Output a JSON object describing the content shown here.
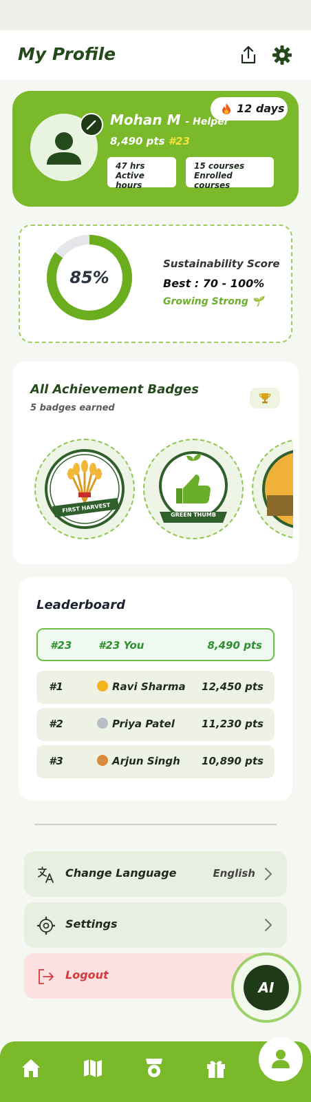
{
  "header": {
    "title": "My Profile",
    "share_icon": "share-icon",
    "settings_icon": "gear-icon"
  },
  "profile": {
    "name": "Mohan M",
    "role": "- Helper",
    "points": "8,490 pts",
    "rank": "#23",
    "streak": "12 days",
    "stats": [
      {
        "value": "47 hrs",
        "label": "Active hours"
      },
      {
        "value": "15 courses",
        "label": "Enrolled courses"
      }
    ]
  },
  "score": {
    "value_text": "85%",
    "value": 85,
    "title": "Sustainability Score",
    "best": "Best : 70 - 100%",
    "status": "Growing Strong 🌱"
  },
  "badges": {
    "title": "All Achievement Badges",
    "subtitle": "5 badges earned",
    "items": [
      {
        "label": "FIRST HARVEST",
        "icon": "wheat-icon"
      },
      {
        "label": "GREEN THUMB",
        "icon": "thumbs-up-icon"
      },
      {
        "label": "",
        "icon": "landscape-icon"
      }
    ]
  },
  "leaderboard": {
    "title": "Leaderboard",
    "you": {
      "rank": "#23",
      "name": "#23 You",
      "points": "8,490 pts"
    },
    "rows": [
      {
        "rank": "#1",
        "name": "Ravi Sharma",
        "points": "12,450 pts",
        "medal_color": "#f2b51d"
      },
      {
        "rank": "#2",
        "name": "Priya Patel",
        "points": "11,230 pts",
        "medal_color": "#b8bec7"
      },
      {
        "rank": "#3",
        "name": "Arjun Singh",
        "points": "10,890 pts",
        "medal_color": "#d98a3c"
      }
    ]
  },
  "menu": {
    "language_label": "Change Language",
    "language_value": "English",
    "settings_label": "Settings",
    "logout_label": "Logout"
  },
  "ai_button": "AI",
  "nav": [
    "home-icon",
    "map-icon",
    "badge-icon",
    "gift-icon",
    "profile-icon"
  ],
  "colors": {
    "brand_green": "#7ab92a",
    "dark_green": "#1f3a17",
    "danger": "#d63a3a"
  }
}
